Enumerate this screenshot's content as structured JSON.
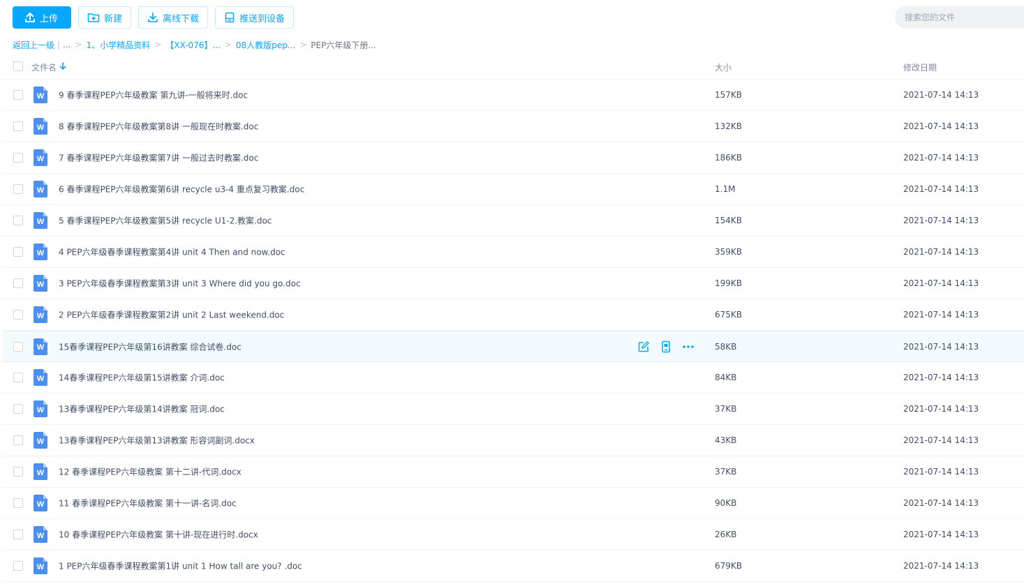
{
  "toolbar": {
    "upload_label": "上传",
    "new_label": "新建",
    "offline_label": "离线下载",
    "push_label": "推送到设备"
  },
  "search": {
    "placeholder": "搜索您的文件"
  },
  "breadcrumb": {
    "back": "返回上一级",
    "ellipsis": "...",
    "items": [
      "1、小学精品资料",
      "【XX-076】...",
      "08人教版pep..."
    ],
    "current": "PEP六年级下册..."
  },
  "columns": {
    "name": "文件名",
    "size": "大小",
    "date": "修改日期"
  },
  "icon_letter": "W",
  "colors": {
    "accent": "#06a7ff",
    "doc_icon": "#4b8ff3",
    "text": "#424e67"
  },
  "files": [
    {
      "name": "9 春季课程PEP六年级教案 第九讲-一般将来时.doc",
      "size": "157KB",
      "date": "2021-07-14 14:13"
    },
    {
      "name": "8 春季课程PEP六年级教案第8讲 一般现在时教案.doc",
      "size": "132KB",
      "date": "2021-07-14 14:13"
    },
    {
      "name": "7 春季课程PEP六年级教案第7讲 一般过去时教案.doc",
      "size": "186KB",
      "date": "2021-07-14 14:13"
    },
    {
      "name": "6 春季课程PEP六年级教案第6讲 recycle u3-4 重点复习教案.doc",
      "size": "1.1M",
      "date": "2021-07-14 14:13"
    },
    {
      "name": "5 春季课程PEP六年级教案第5讲 recycle U1-2.教案.doc",
      "size": "154KB",
      "date": "2021-07-14 14:13"
    },
    {
      "name": "4 PEP六年级春季课程教案第4讲 unit 4 Then and now.doc",
      "size": "359KB",
      "date": "2021-07-14 14:13"
    },
    {
      "name": "3 PEP六年级春季课程教案第3讲 unit 3 Where did you go.doc",
      "size": "199KB",
      "date": "2021-07-14 14:13"
    },
    {
      "name": "2 PEP六年级春季课程教案第2讲 unit 2 Last weekend.doc",
      "size": "675KB",
      "date": "2021-07-14 14:13"
    },
    {
      "name": "15春季课程PEP六年级第16讲教案 综合试卷.doc",
      "size": "58KB",
      "date": "2021-07-14 14:13"
    },
    {
      "name": "14春季课程PEP六年级第15讲教案 介词.doc",
      "size": "84KB",
      "date": "2021-07-14 14:13"
    },
    {
      "name": "13春季课程PEP六年级第14讲教案 冠词.doc",
      "size": "37KB",
      "date": "2021-07-14 14:13"
    },
    {
      "name": "13春季课程PEP六年级第13讲教案 形容词副词.docx",
      "size": "43KB",
      "date": "2021-07-14 14:13"
    },
    {
      "name": "12 春季课程PEP六年级教案 第十二讲-代词.docx",
      "size": "37KB",
      "date": "2021-07-14 14:13"
    },
    {
      "name": "11 春季课程PEP六年级教案 第十一讲-名词.doc",
      "size": "90KB",
      "date": "2021-07-14 14:13"
    },
    {
      "name": "10 春季课程PEP六年级教案 第十讲-现在进行时.docx",
      "size": "26KB",
      "date": "2021-07-14 14:13"
    },
    {
      "name": "1 PEP六年级春季课程教案第1讲 unit 1 How tall are you? .doc",
      "size": "679KB",
      "date": "2021-07-14 14:13"
    }
  ],
  "hover_row_index": 8
}
